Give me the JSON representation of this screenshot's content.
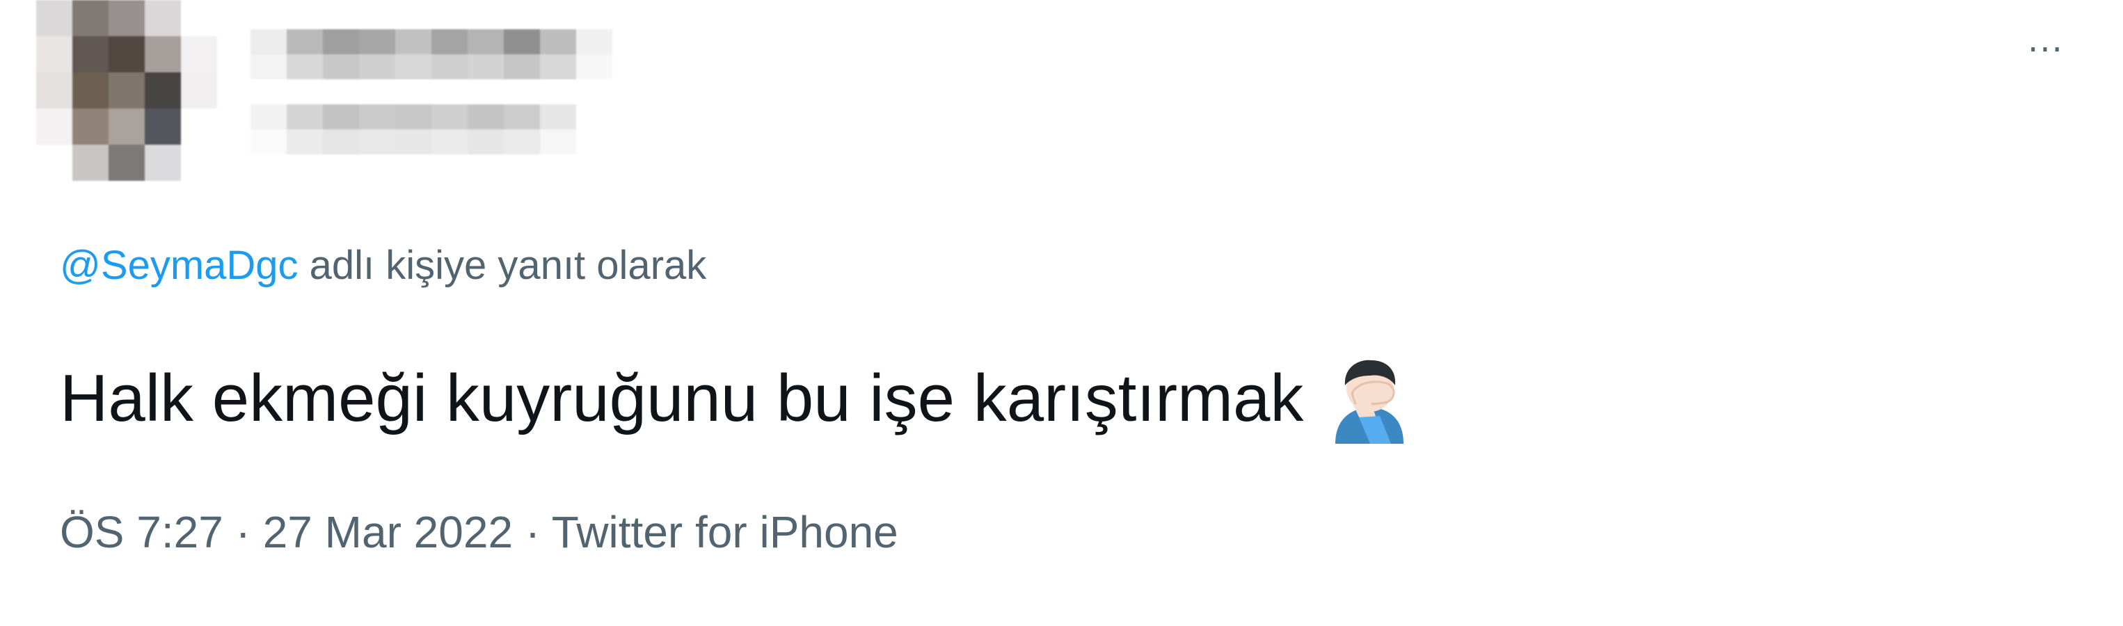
{
  "tweet": {
    "reply_prefix": "@SeymaDgc",
    "reply_suffix": " adlı kişiye yanıt olarak",
    "text": "Halk ekmeği kuyruğunu bu işe karıştırmak",
    "emoji": "facepalm-icon",
    "meta": {
      "time": "ÖS 7:27",
      "separator_1": " · ",
      "date": "27 Mar 2022",
      "separator_2": " · ",
      "source": "Twitter for iPhone"
    },
    "more_label": "···"
  },
  "colors": {
    "link": "#1d9bf0",
    "secondary_text": "#536471",
    "primary_text": "#0f1419",
    "background": "#ffffff"
  }
}
